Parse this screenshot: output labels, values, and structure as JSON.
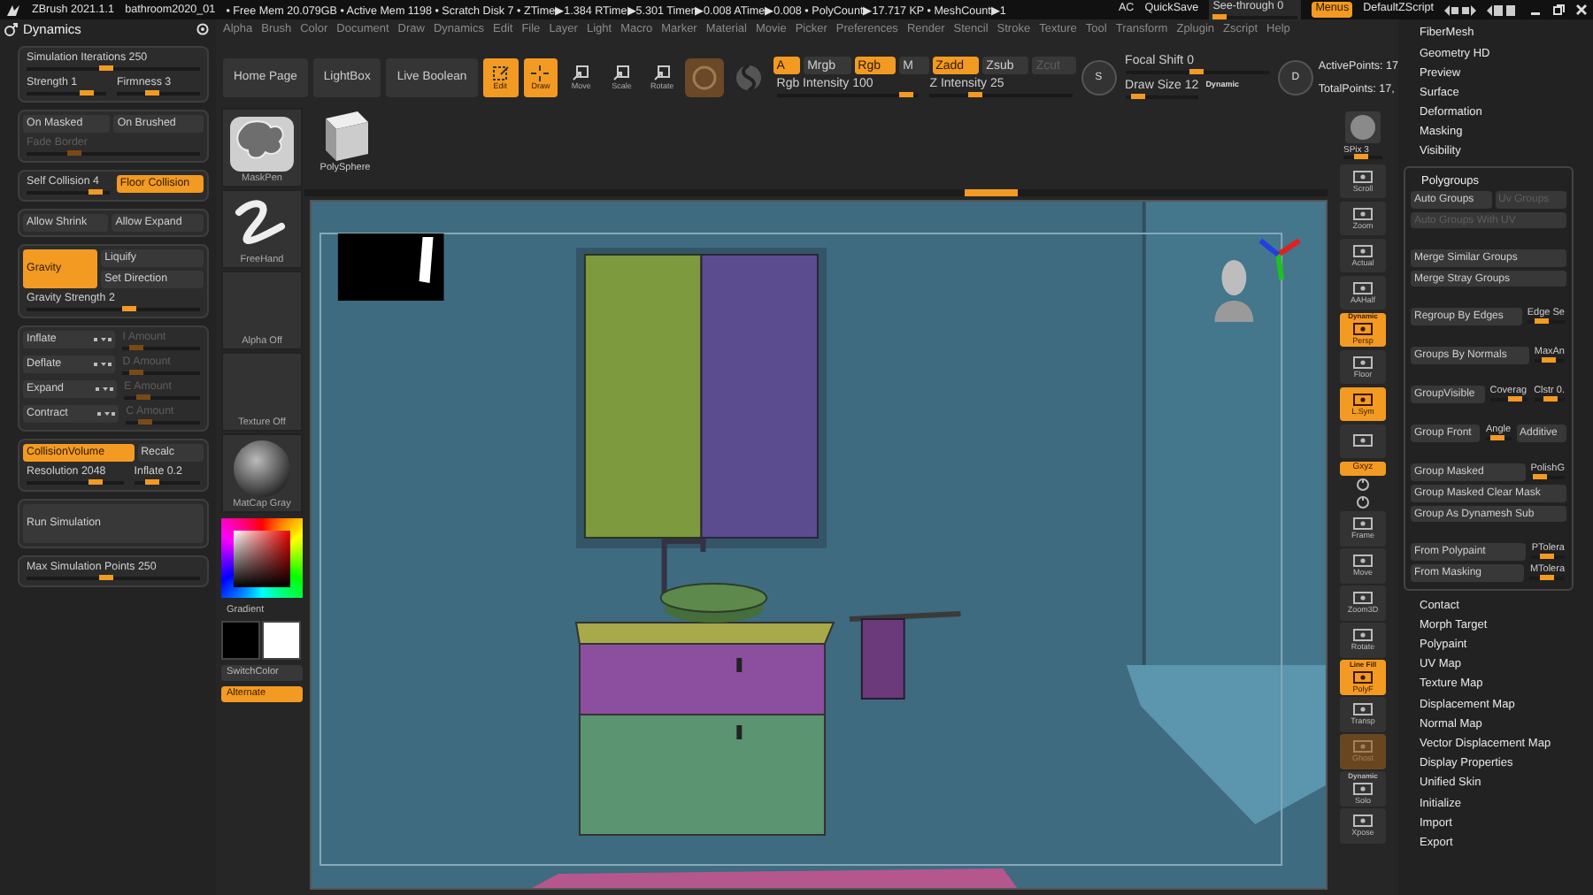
{
  "title_bar": {
    "app": "ZBrush 2021.1.1",
    "document": "bathroom2020_01",
    "stats": "• Free Mem 20.079GB • Active Mem 1198 • Scratch Disk 7 • ZTime▶1.384 RTime▶5.301 Timer▶0.008 ATime▶0.008 • PolyCount▶17.717 KP • MeshCount▶1",
    "controls": [
      {
        "kind": "text",
        "label": "AC"
      },
      {
        "kind": "text",
        "label": "QuickSave"
      },
      {
        "kind": "slider",
        "label": "See-through",
        "value": "0",
        "level": 0,
        "disabled": false
      },
      {
        "kind": "toggle",
        "label": "Menus",
        "on": true,
        "disabled": false
      },
      {
        "kind": "text",
        "label": "DefaultZScript"
      }
    ]
  },
  "left_panel": {
    "title": "Dynamics",
    "groups": [
      {
        "rows": [
          [
            {
              "kind": "slider",
              "label": "Simulation Iterations",
              "value": "250",
              "level": 0.45,
              "disabled": false
            }
          ],
          [
            {
              "kind": "slider",
              "label": "Strength",
              "value": "1",
              "level": 0.8,
              "disabled": false
            },
            {
              "kind": "slider",
              "label": "Firmness",
              "value": "3",
              "level": 0.4,
              "disabled": false
            }
          ]
        ]
      },
      {
        "rows": [
          [
            {
              "kind": "button",
              "label": "On Masked",
              "on": false,
              "disabled": false
            },
            {
              "kind": "button",
              "label": "On Brushed",
              "on": false,
              "disabled": false
            }
          ],
          [
            {
              "kind": "slider",
              "label": "Fade Border",
              "level": 0.25,
              "disabled": true
            }
          ]
        ]
      },
      {
        "rows": [
          [
            {
              "kind": "slider",
              "label": "Self Collision",
              "value": "4",
              "level": 0.9,
              "disabled": false
            },
            {
              "kind": "button",
              "label": "Floor Collision",
              "on": true,
              "disabled": false
            }
          ]
        ]
      },
      {
        "rows": [
          [
            {
              "kind": "button",
              "label": "Allow Shrink",
              "on": false,
              "disabled": false
            },
            {
              "kind": "button",
              "label": "Allow Expand",
              "on": false,
              "disabled": false
            }
          ]
        ]
      },
      {
        "rows": [
          [
            {
              "kind": "big_button",
              "label": "Gravity",
              "on": true,
              "disabled": false
            },
            {
              "kind": "stack",
              "items": [
                {
                  "kind": "button",
                  "label": "Liquify",
                  "on": false,
                  "disabled": false
                },
                {
                  "kind": "button",
                  "label": "Set Direction",
                  "on": false,
                  "disabled": false
                }
              ]
            }
          ],
          [
            {
              "kind": "slider",
              "label": "Gravity Strength",
              "value": "2",
              "level": 0.6,
              "disabled": false
            }
          ]
        ]
      },
      {
        "rows": [
          [
            {
              "kind": "button",
              "label": "Inflate",
              "on": false,
              "disabled": false,
              "menu_icon": true
            },
            {
              "kind": "slider",
              "label": "I Amount",
              "level": 0.1,
              "disabled": true
            }
          ],
          [
            {
              "kind": "button",
              "label": "Deflate",
              "on": false,
              "disabled": false,
              "menu_icon": true
            },
            {
              "kind": "slider",
              "label": "D Amount",
              "level": 0.1,
              "disabled": true
            }
          ],
          [
            {
              "kind": "button",
              "label": "Expand",
              "on": false,
              "disabled": false,
              "menu_icon": true
            },
            {
              "kind": "slider",
              "label": "E Amount",
              "level": 0.2,
              "disabled": true
            }
          ],
          [
            {
              "kind": "button",
              "label": "Contract",
              "on": false,
              "disabled": false,
              "menu_icon": true
            },
            {
              "kind": "slider",
              "label": "C Amount",
              "level": 0.2,
              "disabled": true
            }
          ]
        ]
      },
      {
        "rows": [
          [
            {
              "kind": "button",
              "label": "CollisionVolume",
              "on": true,
              "disabled": false
            },
            {
              "kind": "button",
              "label": "Recalc",
              "on": false,
              "disabled": false
            }
          ],
          [
            {
              "kind": "slider",
              "label": "Resolution",
              "value": "2048",
              "level": 0.75,
              "disabled": false
            },
            {
              "kind": "slider",
              "label": "Inflate",
              "value": "0.2",
              "level": 0.2,
              "disabled": false
            }
          ]
        ]
      },
      {
        "rows": [
          [
            {
              "kind": "big_button",
              "label": "Run Simulation",
              "on": false,
              "disabled": false
            }
          ]
        ]
      },
      {
        "rows": [
          [
            {
              "kind": "slider",
              "label": "Max Simulation Points",
              "value": "250",
              "level": 0.45,
              "disabled": false
            }
          ]
        ]
      }
    ]
  },
  "menu": [
    "Alpha",
    "Brush",
    "Color",
    "Document",
    "Draw",
    "Dynamics",
    "Edit",
    "File",
    "Layer",
    "Light",
    "Macro",
    "Marker",
    "Material",
    "Movie",
    "Picker",
    "Preferences",
    "Render",
    "Stencil",
    "Stroke",
    "Texture",
    "Tool",
    "Transform",
    "Zplugin",
    "Zscript",
    "Help"
  ],
  "shelf": {
    "nav_buttons": [
      {
        "label": "Home Page"
      },
      {
        "label": "LightBox"
      },
      {
        "label": "Live Boolean"
      }
    ],
    "tools": [
      {
        "kind": "edit",
        "label": "Edit",
        "on": true
      },
      {
        "kind": "draw",
        "label": "Draw",
        "on": true
      },
      {
        "kind": "move",
        "label": "Move",
        "on": false
      },
      {
        "kind": "scale",
        "label": "Scale",
        "on": false
      },
      {
        "kind": "rotate",
        "label": "Rotate",
        "on": false
      }
    ],
    "modes": [
      {
        "label": "A",
        "on": true,
        "disabled": false
      },
      {
        "label": "Mrgb",
        "on": false,
        "disabled": false
      },
      {
        "label": "Rgb",
        "on": true,
        "disabled": false
      },
      {
        "label": "M",
        "on": false,
        "disabled": false
      },
      {
        "label": "Zadd",
        "on": true,
        "disabled": false
      },
      {
        "label": "Zsub",
        "on": false,
        "disabled": false
      },
      {
        "label": "Zcut",
        "on": false,
        "disabled": true
      }
    ],
    "intensity": [
      {
        "label": "Rgb Intensity",
        "value": "100",
        "level": 0.95,
        "disabled": false
      },
      {
        "label": "Z Intensity",
        "value": "25",
        "level": 0.3,
        "disabled": false
      }
    ],
    "stroke_icon_letter": "S",
    "stroke": [
      {
        "label": "Focal Shift",
        "value": "0",
        "level": 0.5,
        "disabled": false
      },
      {
        "label": "Draw Size",
        "value": "12",
        "level": 0.1,
        "disabled": false,
        "tag": "Dynamic"
      }
    ],
    "points_icon_letter": "D",
    "points": [
      "ActivePoints: 17",
      "TotalPoints: 17,"
    ]
  },
  "left_shelf": {
    "thumbnails": [
      {
        "kind": "brush",
        "label": "MaskPen"
      },
      {
        "kind": "stroke",
        "label": "FreeHand"
      },
      {
        "kind": "alpha",
        "label": "Alpha Off"
      },
      {
        "kind": "texture",
        "label": "Texture Off"
      },
      {
        "kind": "material",
        "label": "MatCap Gray"
      }
    ],
    "gradient_label": "Gradient",
    "swatches": [
      {
        "color": "#000000"
      },
      {
        "color": "#ffffff"
      }
    ],
    "switch_color": "SwitchColor",
    "alternate": {
      "label": "Alternate",
      "on": true
    }
  },
  "tool_thumbnail": {
    "label": "PolySphere"
  },
  "view_toolbar": [
    {
      "kind": "spix",
      "label": "SPix 3",
      "level": 0.45
    },
    {
      "kind": "button",
      "label": "Scroll",
      "on": false,
      "disabled": false
    },
    {
      "kind": "button",
      "label": "Zoom",
      "on": false,
      "disabled": false
    },
    {
      "kind": "button",
      "label": "Actual",
      "on": false,
      "disabled": false
    },
    {
      "kind": "button",
      "label": "AAHalf",
      "on": false,
      "disabled": false
    },
    {
      "kind": "button",
      "label": "Persp",
      "caption": "Dynamic",
      "on": true,
      "disabled": false
    },
    {
      "kind": "button",
      "label": "Floor",
      "on": false,
      "disabled": false
    },
    {
      "kind": "button",
      "label": "L.Sym",
      "on": true,
      "disabled": false
    },
    {
      "kind": "button",
      "on": false,
      "disabled": false
    },
    {
      "kind": "small",
      "label": "Gxyz",
      "on": true,
      "disabled": false
    },
    {
      "kind": "mini"
    },
    {
      "kind": "mini"
    },
    {
      "kind": "button",
      "label": "Frame",
      "on": false,
      "disabled": false
    },
    {
      "kind": "button",
      "label": "Move",
      "on": false,
      "disabled": false
    },
    {
      "kind": "button",
      "label": "Zoom3D",
      "on": false,
      "disabled": false
    },
    {
      "kind": "button",
      "label": "Rotate",
      "on": false,
      "disabled": false
    },
    {
      "kind": "button",
      "label": "PolyF",
      "caption": "Line Fill",
      "on": true,
      "disabled": false
    },
    {
      "kind": "button",
      "label": "Transp",
      "on": false,
      "disabled": false
    },
    {
      "kind": "button",
      "label": "Ghost",
      "on": true,
      "disabled": true
    },
    {
      "kind": "button",
      "label": "Solo",
      "caption": "Dynamic",
      "on": false,
      "disabled": false
    },
    {
      "kind": "button",
      "label": "Xpose",
      "on": false,
      "disabled": false
    }
  ],
  "tool_menu": {
    "items_before": [
      "FiberMesh",
      "Geometry HD",
      "Preview",
      "Surface",
      "Deformation",
      "Masking",
      "Visibility"
    ],
    "polygroups": {
      "title": "Polygroups",
      "sections": [
        [
          [
            {
              "kind": "button",
              "label": "Auto Groups",
              "disabled": false
            },
            {
              "kind": "button",
              "label": "Uv Groups",
              "disabled": true
            }
          ],
          [
            {
              "kind": "button",
              "label": "Auto Groups With UV",
              "disabled": true
            }
          ]
        ],
        [
          [
            {
              "kind": "button",
              "label": "Merge Similar Groups",
              "disabled": false
            }
          ],
          [
            {
              "kind": "button",
              "label": "Merge Stray Groups",
              "disabled": false
            }
          ]
        ],
        [
          [
            {
              "kind": "button",
              "label": "Regroup By Edges",
              "disabled": false
            },
            {
              "kind": "slider",
              "label": "Edge Se",
              "level": 0.35,
              "disabled": false
            }
          ]
        ],
        [
          [
            {
              "kind": "button",
              "label": "Groups By Normals",
              "disabled": false
            },
            {
              "kind": "slider",
              "label": "MaxAn",
              "level": 0.4,
              "disabled": false
            }
          ]
        ],
        [
          [
            {
              "kind": "button",
              "label": "GroupVisible",
              "disabled": false
            },
            {
              "kind": "slider",
              "label": "Coverag",
              "level": 0.8,
              "disabled": false
            },
            {
              "kind": "slider",
              "label": "Clstr 0.",
              "level": 0.6,
              "disabled": false
            }
          ]
        ],
        [
          [
            {
              "kind": "button",
              "label": "Group Front",
              "disabled": false
            },
            {
              "kind": "slider",
              "label": "Angle",
              "level": 0.45,
              "disabled": false
            },
            {
              "kind": "button",
              "label": "Additive",
              "disabled": false
            }
          ]
        ],
        [
          [
            {
              "kind": "button",
              "label": "Group Masked",
              "disabled": false
            },
            {
              "kind": "slider",
              "label": "PolishG",
              "level": 0.15,
              "disabled": false
            }
          ],
          [
            {
              "kind": "button",
              "label": "Group Masked Clear Mask",
              "disabled": false
            }
          ],
          [
            {
              "kind": "button",
              "label": "Group As Dynamesh Sub",
              "disabled": false
            }
          ]
        ],
        [
          [
            {
              "kind": "button",
              "label": "From Polypaint",
              "disabled": false
            },
            {
              "kind": "slider",
              "label": "PTolera",
              "level": 0.45,
              "disabled": false
            }
          ],
          [
            {
              "kind": "button",
              "label": "From Masking",
              "disabled": false
            },
            {
              "kind": "slider",
              "label": "MTolera",
              "level": 0.45,
              "disabled": false
            }
          ]
        ]
      ]
    },
    "items_after": [
      "Contact",
      "Morph Target",
      "Polypaint",
      "UV Map",
      "Texture Map",
      "Displacement Map",
      "Normal Map",
      "Vector Displacement Map",
      "Display Properties",
      "Unified Skin",
      "Initialize",
      "Import",
      "Export"
    ]
  }
}
